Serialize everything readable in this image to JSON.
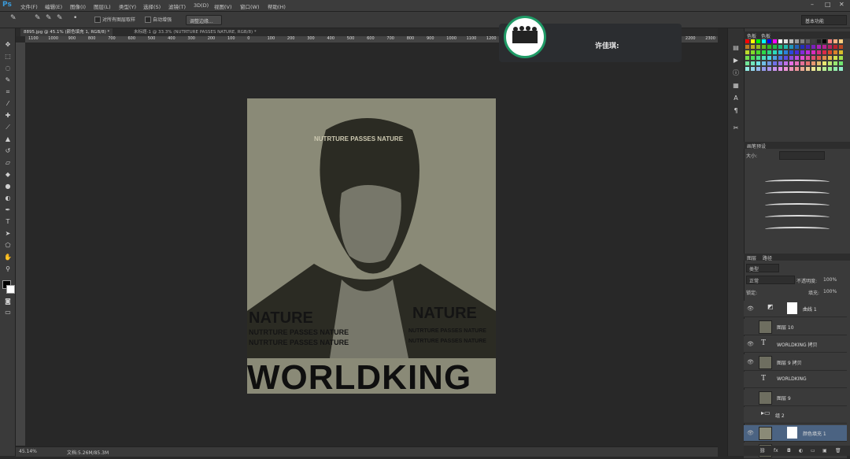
{
  "app": {
    "logo": "Ps"
  },
  "menu": [
    "文件(F)",
    "编辑(E)",
    "图像(I)",
    "图层(L)",
    "类型(Y)",
    "选择(S)",
    "滤镜(T)",
    "3D(D)",
    "视图(V)",
    "窗口(W)",
    "帮助(H)"
  ],
  "options": {
    "sample_all_layers": "对所有图层取样",
    "auto_enhance": "自动增强",
    "refine_edge": "调整边缘...",
    "workspace": "基本功能"
  },
  "tabs": [
    "8895.jpg @ 45.1% (颜色填充 1, RGB/8) *",
    "未标题-1 @ 33.3% (NUTRTURE PASSES NATURE, RGB/8) *"
  ],
  "ruler_numbers": [
    "1100",
    "1000",
    "900",
    "800",
    "700",
    "600",
    "500",
    "400",
    "300",
    "200",
    "100",
    "0",
    "100",
    "200",
    "300",
    "400",
    "500",
    "600",
    "700",
    "800",
    "900",
    "1000",
    "1100",
    "1200",
    "1300",
    "1400",
    "1500",
    "1600",
    "1700",
    "1800",
    "1900",
    "2000",
    "2100",
    "2200",
    "2300"
  ],
  "document": {
    "headline": "WORLDKING",
    "phrase": "NUTRTURE PASSES NATURE",
    "banner_1": "NATURE",
    "banner_2": "NATURE"
  },
  "status": {
    "zoom": "45.14%",
    "doc_info": "文档:5.26M/85.3M"
  },
  "notification": {
    "title": "许佳琪:"
  },
  "panels": {
    "color_tab": "色板",
    "swatch_tab": "色板",
    "brush_preset_tab": "画笔预设",
    "size_label": "大小:",
    "layers_tab": "图层",
    "paths_tab": "路径",
    "filter_kind": "类型",
    "blend_mode": "正常",
    "opacity_label": "不透明度:",
    "opacity_value": "100%",
    "lock_label": "锁定:",
    "fill_label": "填充:",
    "fill_value": "100%"
  },
  "layers": [
    {
      "name": "曲线 1",
      "kind": "adjust",
      "visible": true
    },
    {
      "name": "图层 10",
      "kind": "image",
      "visible": false
    },
    {
      "name": "WORLDKING 拷贝",
      "kind": "text",
      "visible": true
    },
    {
      "name": "图层 9 拷贝",
      "kind": "image",
      "visible": true
    },
    {
      "name": "WORLDKING",
      "kind": "text",
      "visible": false
    },
    {
      "name": "图层 9",
      "kind": "image",
      "visible": false
    },
    {
      "name": "组 2",
      "kind": "group",
      "visible": false
    },
    {
      "name": "颜色填充 1",
      "kind": "fill",
      "visible": true,
      "selected": true
    },
    {
      "name": "图层 8",
      "kind": "image",
      "visible": true
    }
  ],
  "colors": {
    "canvas": "#8a8a77",
    "accent": "#3a9ad9",
    "selected_layer": "#4b6382"
  }
}
